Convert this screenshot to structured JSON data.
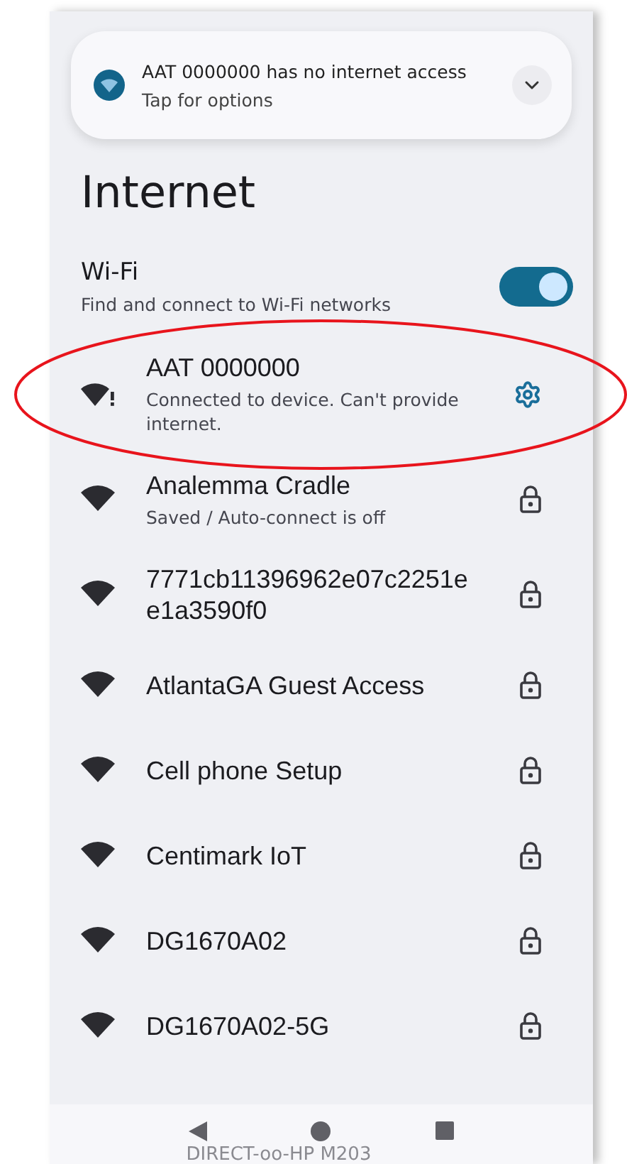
{
  "notification": {
    "title": "AAT 0000000 has no internet access",
    "subtitle": "Tap for options",
    "expanded": false
  },
  "title": "Internet",
  "wifi": {
    "label": "Wi-Fi",
    "description": "Find and connect to Wi-Fi networks",
    "on": true
  },
  "networks": [
    {
      "name": "AAT 0000000",
      "status": "Connected to device. Can't provide internet.",
      "kind": "connected",
      "highlighted": true
    },
    {
      "name": "Analemma Cradle",
      "status": "Saved / Auto-connect is off",
      "kind": "secured",
      "highlighted": false
    },
    {
      "name": "7771cb11396962e07c2251e e1a3590f0",
      "kind": "secured",
      "highlighted": false
    },
    {
      "name": "AtlantaGA Guest Access",
      "kind": "secured",
      "highlighted": false
    },
    {
      "name": "Cell phone Setup",
      "kind": "secured",
      "highlighted": false
    },
    {
      "name": "Centimark IoT",
      "kind": "secured",
      "highlighted": false
    },
    {
      "name": "DG1670A02",
      "kind": "secured",
      "highlighted": false
    },
    {
      "name": "DG1670A02-5G",
      "kind": "secured",
      "highlighted": false
    }
  ],
  "hidden_row": "DIRECT-oo-HP M203"
}
